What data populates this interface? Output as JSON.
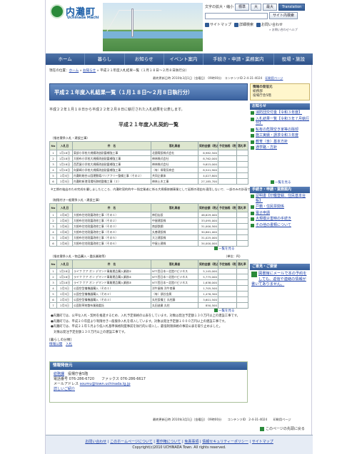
{
  "header": {
    "logo_text": "内灘町",
    "logo_sub": "Uchinada Machi",
    "font_label": "文字の拡大・縮小",
    "font_sizes": [
      "標準",
      "大",
      "最大"
    ],
    "translation_label": "Translation",
    "search_button": "サイト内検索",
    "sitemap": "サイトマップ",
    "detail_search": "詳細検索",
    "inquiry": "お問い合わせ",
    "hint": "» お問い合わせヘルプ"
  },
  "nav": [
    "ホーム",
    "暮らし",
    "お知らせ",
    "イベント案内",
    "手続き・申請・業務案内",
    "役場・施設"
  ],
  "breadcrumb": {
    "prefix": "現在の位置：",
    "home": "ホーム",
    "sep1": " » ",
    "notice": "お知らせ",
    "sep2": " » ",
    "current": "平成２１年度入札結果一覧（１月１８日～２月８日執行分）"
  },
  "updated": {
    "label": "最終更新日時",
    "value": "2010年3月1日（金曜日） 09時00分",
    "content_id_label": "コンテンツID",
    "content_id": "2-4-31-4024",
    "print": "印刷用ページ"
  },
  "page_title": "平成２１年度入札結果一覧（１月１８日～２月８日執行分）",
  "info_box": {
    "title": "情報の発信元",
    "dept": "総務部",
    "section": "役場庁舎5階"
  },
  "intro": "平成２２年１月１８日から平成２２年２月８日に執行された入札結果を公表します。",
  "center_title": "平成２１年度入札契約一覧",
  "sec1": {
    "heading": "（指名競争入札・建設工事）",
    "headers": [
      "No",
      "入札日",
      "件　名",
      "落札業者",
      "契約金額（税込）",
      "予定価格（税込）",
      "落札率（%）"
    ],
    "rows": [
      [
        "1",
        "1月18日",
        "東部小学校大規模改造耐震補強工事",
        "北國電設株式会社",
        "6,982,500",
        "",
        ""
      ],
      [
        "2",
        "1月18日",
        "大根布小学校大規模改造耐震補強工事",
        "神林株式会社",
        "8,762,000",
        "",
        ""
      ],
      [
        "3",
        "1月18日",
        "西荒屋小学校大規模改造耐震補強工事",
        "神林株式会社",
        "9,615,000",
        "",
        ""
      ],
      [
        "4",
        "1月18日",
        "向粟崎小学校大規模改造耐震補強工事",
        "（有）塚電気商会",
        "8,541,900",
        "",
        ""
      ],
      [
        "5",
        "2月5日",
        "内灘町総合公園運動場バリアフリー整備工事（その２）",
        "共同企業体",
        "4,027,800",
        "",
        ""
      ],
      [
        "6",
        "2月5日",
        "内灘町新港湾場所跡地整備工事（２）",
        "神林土木工事",
        "27,185,700",
        "",
        ""
      ]
    ],
    "note": "※工期の抽出のため完成を優しましたところ、内灘町契約約中ー指定業者に係る大規模修繕事業として延期の理由を適用しないで、一部のみの計画で算定しました。"
  },
  "sec2": {
    "heading": "（制限付き一般競争入札・建設工事）",
    "headers": [
      "No",
      "入札日",
      "件　名",
      "落札業者",
      "契約金額（税込）",
      "予定価格（税込）",
      "落札率（%）"
    ],
    "rows": [
      [
        "1",
        "2月8日",
        "大根布住宅耐震改修工事（その１）",
        "神田店設",
        "46,629,000",
        "",
        ""
      ],
      [
        "2",
        "2月8日",
        "大根布住宅耐震改修工事（その２）",
        "中屋建設株",
        "33,095,000",
        "",
        ""
      ],
      [
        "3",
        "2月8日",
        "大根布住宅耐震改修工事（その３）",
        "南部鉄鋼",
        "31,000,500",
        "",
        ""
      ],
      [
        "4",
        "2月8日",
        "大根布住宅耐震改修工事（その４）",
        "丸善建設株",
        "30,861,000",
        "",
        ""
      ],
      [
        "5",
        "2月8日",
        "大根布住宅耐震改修工事（その５）",
        "大江建設株",
        "31,025,000",
        "",
        ""
      ],
      [
        "6",
        "2月8日",
        "大根布住宅耐震改修工事（その６）",
        "中屋土建株",
        "34,000,000",
        "",
        ""
      ]
    ],
    "totop": "一覧を見る"
  },
  "sec3": {
    "heading": "（指名競争入札・物品購入・委託業務等）",
    "unit": "（単位：円）",
    "headers": [
      "No",
      "入札日",
      "件　名",
      "落札業者",
      "契約金額（税込）",
      "予定価格（税込）",
      "落札率（%）"
    ],
    "rows": [
      [
        "1",
        "1月18日",
        "ライフ ケア オン デマンド事業運品購入業務①",
        "NTT西日本一北陸ITビジネス",
        "5,145,000",
        "",
        ""
      ],
      [
        "2",
        "1月18日",
        "ライフ ケア オン デマンド事業運品購入業務②",
        "NTT西日本一北陸ITビジネス",
        "5,775,000",
        "",
        ""
      ],
      [
        "3",
        "1月18日",
        "ライフ ケア オン デマンド事業運品購入業務③",
        "NTT西日本一北陸ITビジネス",
        "1,638,000",
        "",
        ""
      ],
      [
        "4",
        "2月5日",
        "公園空型備機器購入（その１）",
        "洋牛屋株 洋牛商事",
        "1,705,500",
        "",
        ""
      ],
      [
        "5",
        "2月5日",
        "公園空型備機器購入（その２）",
        "（有）須谷金属",
        "1,476,300",
        "",
        ""
      ],
      [
        "6",
        "2月5日",
        "公園空型備機器購入（その３）",
        "丸柱設備工 丸柱藤",
        "3,601,500",
        "",
        ""
      ],
      [
        "7",
        "2月5日",
        "公園防草剤散布業務委託",
        "丸田造業 丸柱",
        "850,500",
        "",
        ""
      ]
    ],
    "totop": "一覧を見る"
  },
  "notes": [
    "●内灘町では、公平な入札・契約を推進するため、入札予定価格の公表をしています。対象は発注予定額１３０万円以上の建設工事です。",
    "●内灘町では、平成２０年度より制限付き一般競争入札を導入しています。対象は発注予定額１０００万円以上の建設工事です。",
    "●内灘町では、平成２１年５月より低入札基準価格制度事前を執行的に導入し、最低制限価格の事前公表を取り止めました。",
    "　対象は発注予定金額１３０万円以上の建設工事です。"
  ],
  "category": {
    "label": "[暮らしの分類]",
    "link1": "情報公開",
    "link2": "入札"
  },
  "sidebar": {
    "news_head": "お知らせ",
    "news": [
      "消防団交付金【令和３年度】",
      "入札結果一覧【令和３年７月執行分】",
      "私有の危険空き家等の除却",
      "施工実績・請求令和３年度",
      "教育（含）基本方針",
      "通学路・方針"
    ],
    "news_more": "一覧を見る",
    "proc_head": "手続き・申請・業務案内",
    "proc": [
      "証明書【印鑑登録、住民基本台帳】",
      "戸籍・住民票関係",
      "電子申請",
      "大規模災害時の手続き",
      "その他の書類について"
    ],
    "opinion_head": "ご意見・ご要望",
    "opinion": "図書館にメールで本の予約をしても、返信や連絡の情報が書いてありません。"
  },
  "overlay_table": {
    "headers": [
      "予定価格（税込）",
      "落札率（%）"
    ],
    "rows": [
      [
        "7,000,000",
        "70.00"
      ],
      [
        "8,000,000",
        "70.00"
      ],
      [
        "10,000,000",
        "79.15"
      ]
    ],
    "rows2": [
      [
        "49,000,000",
        "93.47"
      ]
    ],
    "rows3": [
      [
        "28,140,000",
        "96.32"
      ]
    ]
  },
  "infosrc": {
    "head": "情報発信元",
    "dept": "総務課",
    "floor": "役場庁舎5階",
    "tel_label": "電話番号",
    "tel": "076-286-6720",
    "fax_label": "ファックス",
    "fax": "076-286-6617",
    "mail_label": "メールアドレス",
    "mail": "soumu@town.uchinada.lg.jp",
    "more": "詳しいご紹介"
  },
  "footer_updated": "最終更新日時 2010年3月1日（金曜日） 09時00分　　コンテンツID　2-4-31-4024　　印刷用ページ",
  "pagetop": "このページの先頭に戻る",
  "footer": {
    "links": [
      "お問い合わせ",
      "このホームページについて",
      "著作権について",
      "免責事項",
      "情報セキュリティーポリシー",
      "サイトマップ"
    ],
    "copyright": "Copyright(c)2010 UCHINADA Town. All rights reserved."
  }
}
